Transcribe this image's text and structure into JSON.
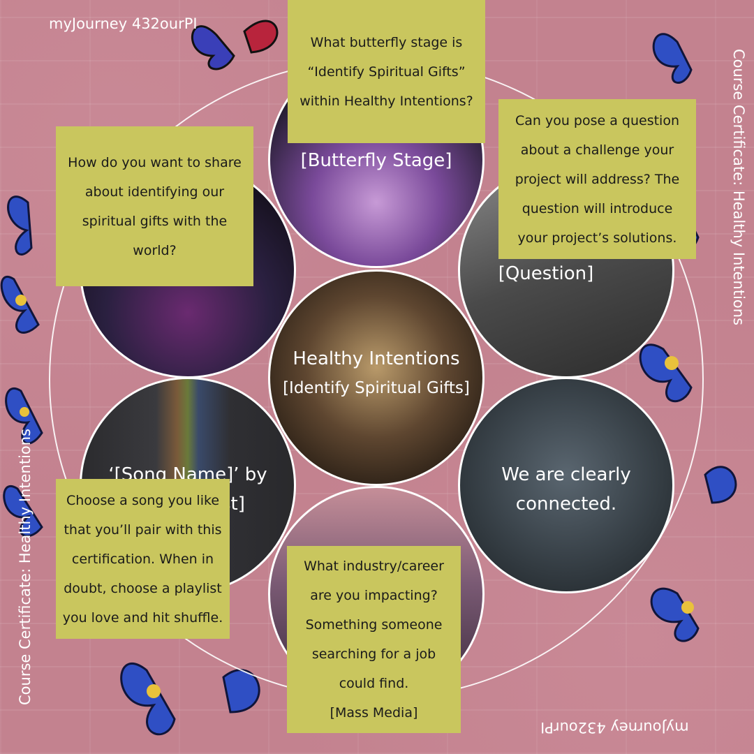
{
  "brand": {
    "top_left": "myJourney 432ourPI",
    "bottom_right": "myJourney 432ourPI"
  },
  "side_labels": {
    "right": "Course Certificate: Healthy Intentions",
    "left": "Course Certificate: Healthy Intentions"
  },
  "circles": {
    "top": "[Butterfly Stage]",
    "top_right": "[Question]",
    "center_title": "Healthy Intentions",
    "center_subtitle": "[Identify Spiritual Gifts]",
    "bottom_right_1": "We are clearly",
    "bottom_right_2": "connected.",
    "bottom_left_1": "‘[Song Name]’ by",
    "bottom_left_2": "st]"
  },
  "notes": {
    "top": "What butterfly stage is\n“Identify Spiritual Gifts”\nwithin Healthy Intentions?",
    "top_right": "Can you pose a question\nabout a challenge your\nproject will address? The\nquestion will introduce\nyour project’s solutions.",
    "top_left": "How do you want to share\nabout identifying our\nspiritual gifts with the\nworld?",
    "bottom_left": "Choose a song you like\nthat you’ll pair with this\ncertification. When in\ndoubt, choose a playlist\nyou love and hit shuffle.",
    "bottom": "What industry/career\nare you impacting?\nSomething someone\nsearching for a job\ncould find.\n[Mass Media]"
  }
}
